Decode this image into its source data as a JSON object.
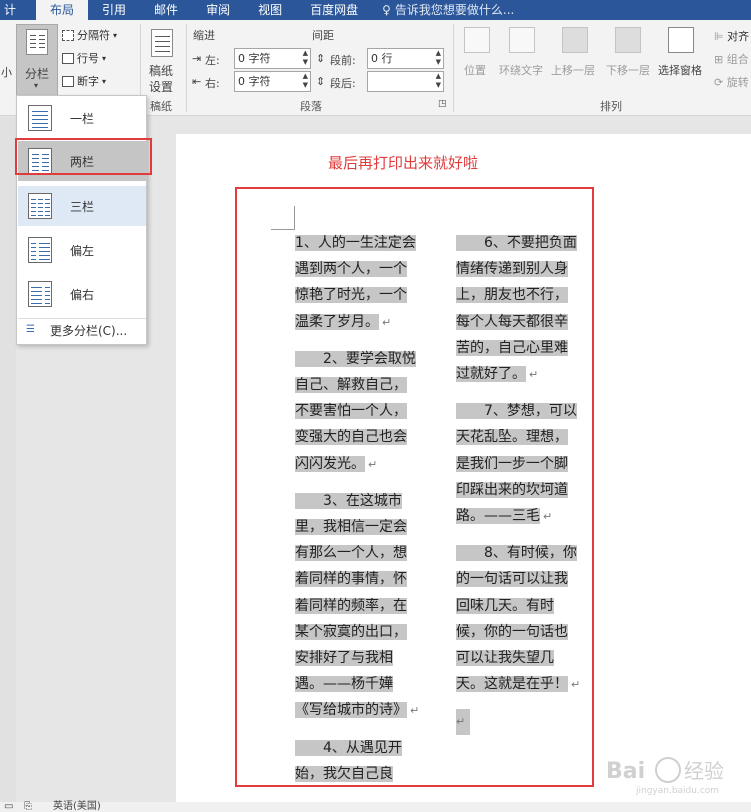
{
  "tabs": [
    {
      "label": "计",
      "active": false
    },
    {
      "label": "布局",
      "active": true
    },
    {
      "label": "引用",
      "active": false
    },
    {
      "label": "邮件",
      "active": false
    },
    {
      "label": "审阅",
      "active": false
    },
    {
      "label": "视图",
      "active": false
    },
    {
      "label": "百度网盘",
      "active": false
    }
  ],
  "tell_me": "告诉我您想要做什么...",
  "ribbon": {
    "size_label": "小",
    "columns_label": "分栏",
    "breaks_label": "分隔符",
    "line_numbers_label": "行号",
    "hyphenation_label": "断字",
    "manuscript_label_1": "稿纸",
    "manuscript_label_2": "设置",
    "manuscript_group": "稿纸",
    "indent_title": "缩进",
    "spacing_title": "间距",
    "indent_left_label": "左:",
    "indent_left_value": "0 字符",
    "indent_right_label": "右:",
    "indent_right_value": "0 字符",
    "spacing_before_label": "段前:",
    "spacing_before_value": "0 行",
    "spacing_after_label": "段后:",
    "spacing_after_value": "",
    "paragraph_group": "段落",
    "position_label": "位置",
    "wrap_text_label": "环绕文字",
    "bring_forward_label": "上移一层",
    "send_backward_label": "下移一层",
    "selection_pane_label": "选择窗格",
    "align_label": "对齐",
    "group_label": "组合",
    "rotate_label": "旋转",
    "arrange_group": "排列"
  },
  "dropdown": {
    "items": [
      {
        "label": "一栏",
        "cols": 1
      },
      {
        "label": "两栏",
        "cols": 2
      },
      {
        "label": "三栏",
        "cols": 3
      },
      {
        "label": "偏左",
        "cols": 2
      },
      {
        "label": "偏右",
        "cols": 2
      }
    ],
    "selected": "两栏",
    "more_label": "更多分栏(C)..."
  },
  "document": {
    "caption": "最后再打印出来就好啦",
    "left_column": [
      {
        "lines": [
          "1、人的一生注定会",
          "遇到两个人，一个",
          "惊艳了时光，一个",
          "温柔了岁月。"
        ],
        "indent": false
      },
      {
        "lines": [
          "2、要学会取悦",
          "自己、解救自己，",
          "不要害怕一个人，",
          "变强大的自己也会",
          "闪闪发光。"
        ],
        "indent": true
      },
      {
        "lines": [
          "3、在这城市",
          "里，我相信一定会",
          "有那么一个人，想",
          "着同样的事情，怀",
          "着同样的频率，在",
          "某个寂寞的出口，",
          "安排好了与我相",
          "遇。——杨千嬅",
          "《写给城市的诗》"
        ],
        "indent": true
      },
      {
        "lines": [
          "4、从遇见开",
          "始，我欠自己良"
        ],
        "indent": true
      }
    ],
    "right_column": [
      {
        "lines": [
          "6、不要把负面",
          "情绪传递到别人身",
          "上，朋友也不行，",
          "每个人每天都很辛",
          "苦的，自己心里难",
          "过就好了。"
        ],
        "indent": true
      },
      {
        "lines": [
          "7、梦想，可以",
          "天花乱坠。理想，",
          "是我们一步一个脚",
          "印踩出来的坎坷道",
          "路。——三毛"
        ],
        "indent": true
      },
      {
        "lines": [
          "8、有时候，你",
          "的一句话可以让我",
          "回味几天。有时",
          "候，你的一句话也",
          "可以让我失望几",
          "天。这就是在乎！"
        ],
        "indent": true
      }
    ]
  },
  "status": {
    "language": "英语(美国)"
  },
  "watermark": {
    "text": "经验",
    "domain": "jingyan.baidu.com",
    "brand": "Bai"
  },
  "colors": {
    "accent": "#2b579a",
    "annotation": "#e03c3c",
    "highlight": "#c6c6c6"
  }
}
